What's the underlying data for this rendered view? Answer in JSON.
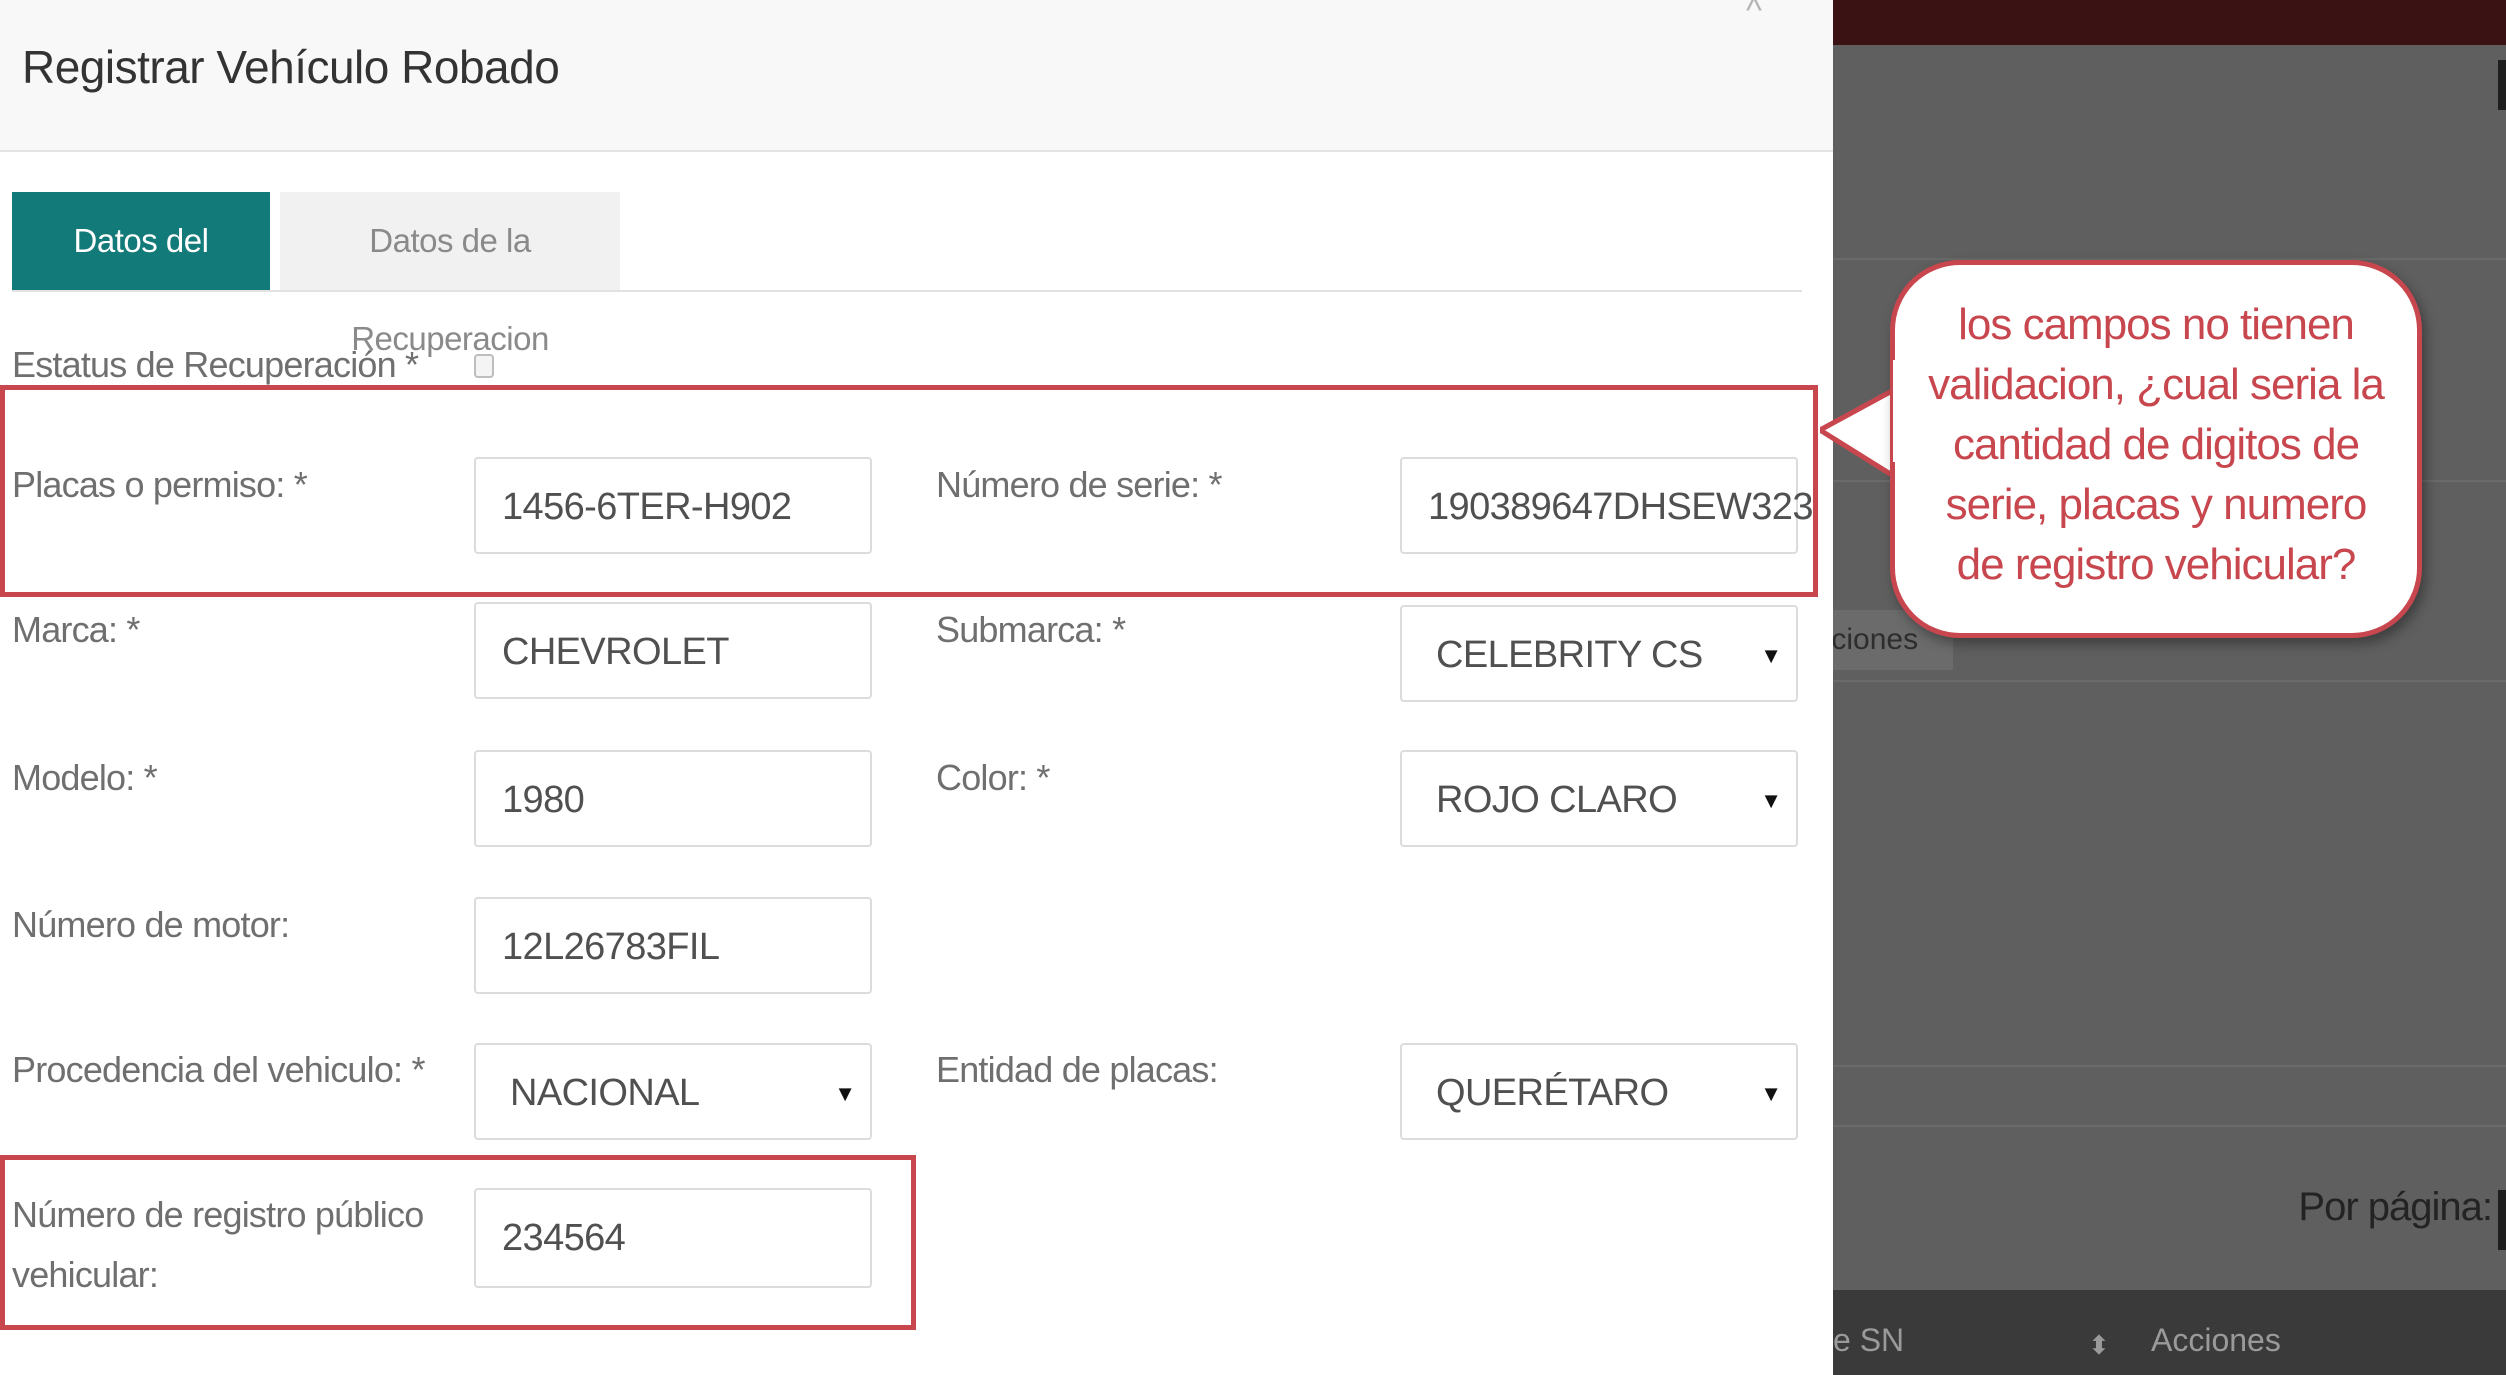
{
  "modal": {
    "title": "Registrar Vehículo Robado",
    "tabs": [
      {
        "label": "Datos del Vehiculo",
        "active": true
      },
      {
        "label": "Datos de la Recuperacion",
        "active": false
      }
    ],
    "fields": {
      "estatus_label": "Estatus de Recuperación *",
      "estatus_checked": false,
      "placas_label": "Placas o permiso: *",
      "placas_value": "1456-6TER-H902",
      "serie_label": "Número de serie: *",
      "serie_value": "190389647DHSEW323",
      "marca_label": "Marca: *",
      "marca_value": "CHEVROLET",
      "submarca_label": "Submarca: *",
      "submarca_value": "CELEBRITY CS",
      "modelo_label": "Modelo: *",
      "modelo_value": "1980",
      "color_label": "Color: *",
      "color_value": "ROJO CLARO",
      "motor_label": "Número de motor:",
      "motor_value": "12L26783FIL",
      "procedencia_label": "Procedencia del vehiculo: *",
      "procedencia_value": "NACIONAL",
      "entidad_label": "Entidad de placas:",
      "entidad_value": "QUERÉTARO",
      "registro_label_line1": "Número de registro público",
      "registro_label_line2": "vehicular:",
      "registro_value": "234564"
    }
  },
  "annotation": {
    "text": "los campos no tienen validacion, ¿cual seria la cantidad de digitos de serie, placas y numero de registro vehicular?"
  },
  "background": {
    "tab_fragment": "naciones",
    "per_page_label": "Por página:",
    "column_sn": "e SN",
    "column_actions": "Acciones"
  },
  "colors": {
    "accent_teal": "#127a78",
    "annotation_red": "#c8474e",
    "topbar_maroon": "#3b1214"
  }
}
